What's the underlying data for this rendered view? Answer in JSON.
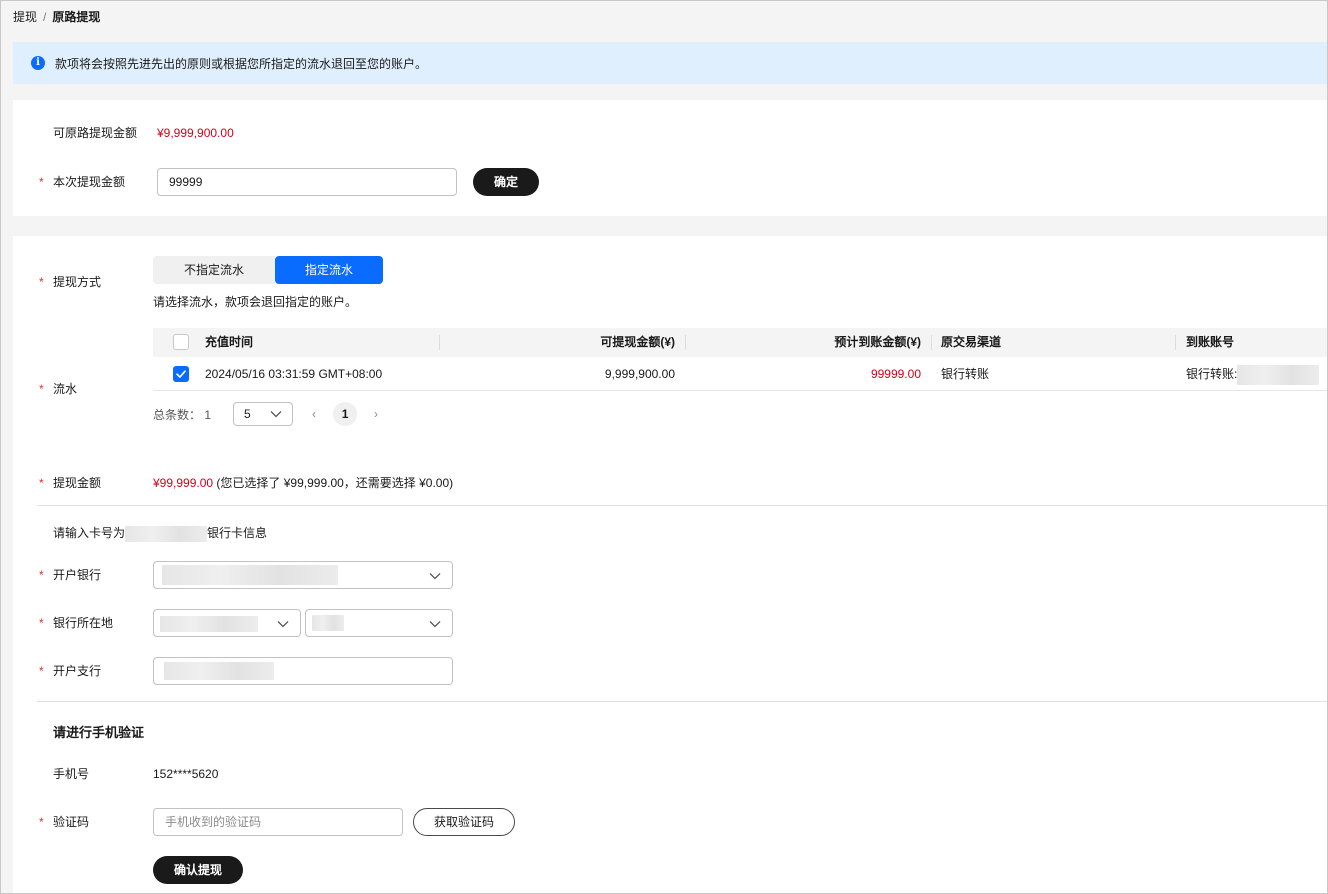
{
  "breadcrumb": {
    "parent": "提现",
    "separator": "/",
    "current": "原路提现"
  },
  "alert": {
    "text": "款项将会按照先进先出的原则或根据您所指定的流水退回至您的账户。"
  },
  "summary": {
    "available_label": "可原路提现金额",
    "available_value": "¥9,999,900.00",
    "amount_label": "本次提现金额",
    "amount_value": "99999",
    "confirm_button": "确定"
  },
  "method": {
    "label": "提现方式",
    "options": [
      "不指定流水",
      "指定流水"
    ],
    "selected": "指定流水",
    "hint": "请选择流水，款项会退回指定的账户。"
  },
  "flow": {
    "label": "流水",
    "columns": [
      "充值时间",
      "可提现金额(¥)",
      "预计到账金额(¥)",
      "原交易渠道",
      "到账账号"
    ],
    "rows": [
      {
        "checked": true,
        "time": "2024/05/16 03:31:59 GMT+08:00",
        "withdrawable": "9,999,900.00",
        "expected": "99999.00",
        "channel": "银行转账",
        "account": "银行转账:"
      }
    ],
    "pager": {
      "total_label": "总条数：",
      "total": "1",
      "page_size": "5",
      "current_page": "1",
      "prev": "‹",
      "next": "›"
    }
  },
  "withdraw_amount": {
    "label": "提现金额",
    "value": "¥99,999.00",
    "note": "(您已选择了 ¥99,999.00，还需要选择 ¥0.00)"
  },
  "bank": {
    "prompt_prefix": "请输入卡号为",
    "prompt_suffix": "银行卡信息",
    "bank_label": "开户银行",
    "location_label": "银行所在地",
    "branch_label": "开户支行"
  },
  "verify": {
    "title": "请进行手机验证",
    "phone_label": "手机号",
    "phone_value": "152****5620",
    "code_label": "验证码",
    "code_placeholder": "手机收到的验证码",
    "get_code_button": "获取验证码",
    "submit_button": "确认提现"
  },
  "colors": {
    "accent": "#0a6cff",
    "danger": "#d0021b",
    "required": "#e4312b",
    "alert_bg": "#e0effe"
  },
  "icons": {
    "info": "info-icon",
    "check": "check-icon",
    "chevron": "chevron-down-icon"
  }
}
